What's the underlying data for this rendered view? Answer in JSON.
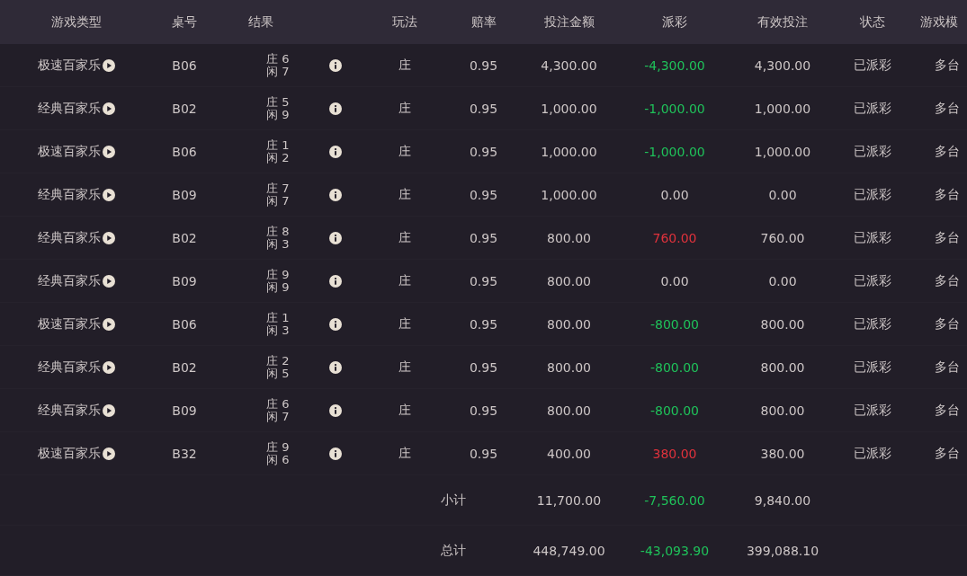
{
  "table": {
    "columns": [
      "游戏类型",
      "桌号",
      "结果",
      "玩法",
      "赔率",
      "投注金额",
      "派彩",
      "有效投注",
      "状态",
      "游戏模"
    ],
    "rows": [
      {
        "game_type": "极速百家乐",
        "table_no": "B06",
        "result": [
          "庄 6",
          "闲 7"
        ],
        "play": "庄",
        "odds": "0.95",
        "bet": "4,300.00",
        "payout": "-4,300.00",
        "color": "#1fc25a",
        "valid_bet": "4,300.00",
        "status": "已派彩",
        "mode": "多台"
      },
      {
        "game_type": "经典百家乐",
        "table_no": "B02",
        "result": [
          "庄 5",
          "闲 9"
        ],
        "play": "庄",
        "odds": "0.95",
        "bet": "1,000.00",
        "payout": "-1,000.00",
        "color": "#1fc25a",
        "valid_bet": "1,000.00",
        "status": "已派彩",
        "mode": "多台"
      },
      {
        "game_type": "极速百家乐",
        "table_no": "B06",
        "result": [
          "庄 1",
          "闲 2"
        ],
        "play": "庄",
        "odds": "0.95",
        "bet": "1,000.00",
        "payout": "-1,000.00",
        "color": "#1fc25a",
        "valid_bet": "1,000.00",
        "status": "已派彩",
        "mode": "多台"
      },
      {
        "game_type": "经典百家乐",
        "table_no": "B09",
        "result": [
          "庄 7",
          "闲 7"
        ],
        "play": "庄",
        "odds": "0.95",
        "bet": "1,000.00",
        "payout": "0.00",
        "color": "#cdc6c6",
        "valid_bet": "0.00",
        "status": "已派彩",
        "mode": "多台"
      },
      {
        "game_type": "经典百家乐",
        "table_no": "B02",
        "result": [
          "庄 8",
          "闲 3"
        ],
        "play": "庄",
        "odds": "0.95",
        "bet": "800.00",
        "payout": "760.00",
        "color": "#e0323c",
        "valid_bet": "760.00",
        "status": "已派彩",
        "mode": "多台"
      },
      {
        "game_type": "经典百家乐",
        "table_no": "B09",
        "result": [
          "庄 9",
          "闲 9"
        ],
        "play": "庄",
        "odds": "0.95",
        "bet": "800.00",
        "payout": "0.00",
        "color": "#cdc6c6",
        "valid_bet": "0.00",
        "status": "已派彩",
        "mode": "多台"
      },
      {
        "game_type": "极速百家乐",
        "table_no": "B06",
        "result": [
          "庄 1",
          "闲 3"
        ],
        "play": "庄",
        "odds": "0.95",
        "bet": "800.00",
        "payout": "-800.00",
        "color": "#1fc25a",
        "valid_bet": "800.00",
        "status": "已派彩",
        "mode": "多台"
      },
      {
        "game_type": "经典百家乐",
        "table_no": "B02",
        "result": [
          "庄 2",
          "闲 5"
        ],
        "play": "庄",
        "odds": "0.95",
        "bet": "800.00",
        "payout": "-800.00",
        "color": "#1fc25a",
        "valid_bet": "800.00",
        "status": "已派彩",
        "mode": "多台"
      },
      {
        "game_type": "经典百家乐",
        "table_no": "B09",
        "result": [
          "庄 6",
          "闲 7"
        ],
        "play": "庄",
        "odds": "0.95",
        "bet": "800.00",
        "payout": "-800.00",
        "color": "#1fc25a",
        "valid_bet": "800.00",
        "status": "已派彩",
        "mode": "多台"
      },
      {
        "game_type": "极速百家乐",
        "table_no": "B32",
        "result": [
          "庄 9",
          "闲 6"
        ],
        "play": "庄",
        "odds": "0.95",
        "bet": "400.00",
        "payout": "380.00",
        "color": "#e0323c",
        "valid_bet": "380.00",
        "status": "已派彩",
        "mode": "多台"
      }
    ],
    "summary": [
      {
        "label": "小计",
        "bet": "11,700.00",
        "payout": "-7,560.00",
        "color": "#1fc25a",
        "valid_bet": "9,840.00"
      },
      {
        "label": "总计",
        "bet": "448,749.00",
        "payout": "-43,093.90",
        "color": "#1fc25a",
        "valid_bet": "399,088.10"
      }
    ]
  }
}
